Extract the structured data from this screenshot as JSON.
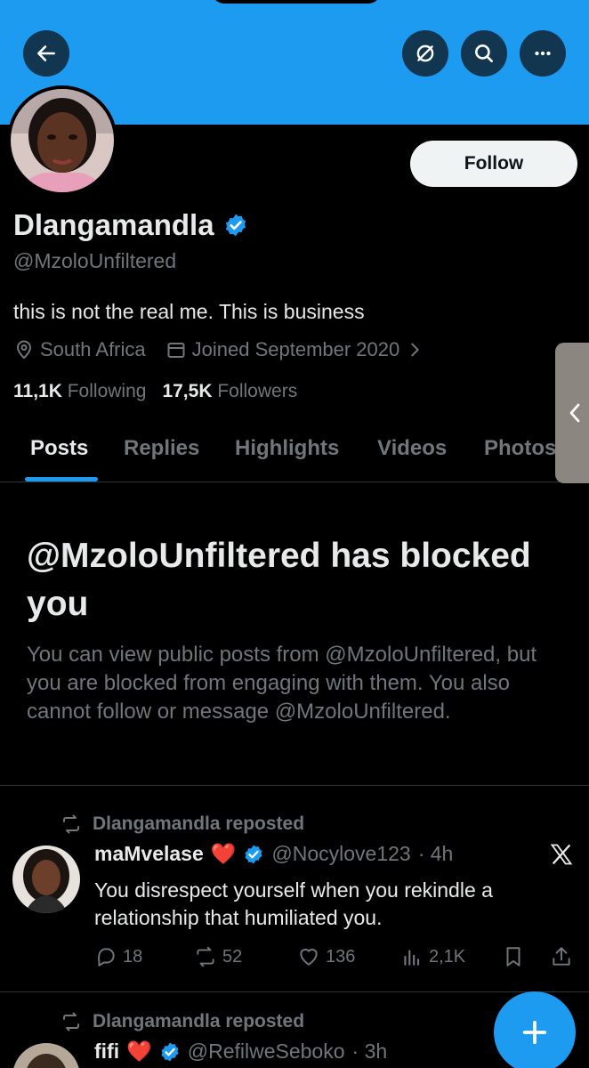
{
  "header": {
    "back_icon": "arrow-left-icon",
    "actions": [
      "notifications-off-icon",
      "search-icon",
      "more-icon"
    ]
  },
  "profile": {
    "follow_label": "Follow",
    "name": "Dlangamandla",
    "verified": true,
    "handle": "@MzoloUnfiltered",
    "bio": "this is not the real me. This is business",
    "location": "South Africa",
    "joined": "Joined September 2020",
    "following_count": "11,1K",
    "following_label": "Following",
    "followers_count": "17,5K",
    "followers_label": "Followers"
  },
  "tabs": [
    {
      "label": "Posts",
      "active": true
    },
    {
      "label": "Replies",
      "active": false
    },
    {
      "label": "Highlights",
      "active": false
    },
    {
      "label": "Videos",
      "active": false
    },
    {
      "label": "Photos",
      "active": false
    }
  ],
  "blocked": {
    "title": "@MzoloUnfiltered has blocked you",
    "description": "You can view public posts from @MzoloUnfiltered, but you are blocked from engaging with them. You also cannot follow or message @MzoloUnfiltered."
  },
  "posts": [
    {
      "repost_label": "Dlangamandla reposted",
      "author_name": "maMvelase",
      "author_emoji": "❤️",
      "verified": true,
      "author_handle": "@Nocylove123",
      "time": "· 4h",
      "text": "You disrespect yourself when you rekindle a relationship that humiliated you.",
      "replies": "18",
      "reposts": "52",
      "likes": "136",
      "views": "2,1K"
    },
    {
      "repost_label": "Dlangamandla reposted",
      "author_name": "fifi",
      "author_emoji": "❤️",
      "verified": true,
      "author_handle": "@RefilweSeboko",
      "time": "· 3h"
    }
  ],
  "colors": {
    "accent": "#1d9bf0",
    "background": "#000000",
    "secondary_text": "#71767b",
    "primary_text": "#e7e9ea"
  }
}
